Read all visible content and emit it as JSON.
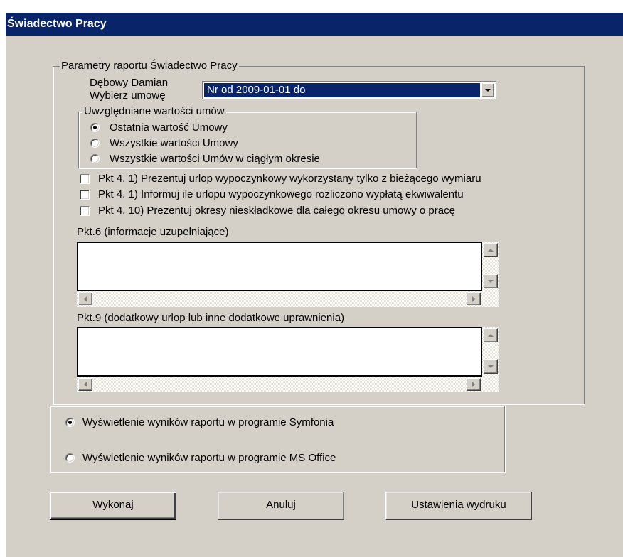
{
  "window": {
    "title": "Świadectwo Pracy"
  },
  "params": {
    "legend": "Parametry raportu  Świadectwo Pracy",
    "employee": "Dębowy Damian",
    "contract_label": "Wybierz umowę",
    "contract_value": "Nr  od 2009-01-01 do",
    "values_group": {
      "legend": "Uwzględniane wartości umów",
      "options": [
        {
          "label": "Ostatnia wartość Umowy",
          "selected": true
        },
        {
          "label": "Wszystkie wartości Umowy",
          "selected": false
        },
        {
          "label": "Wszystkie wartości Umów w ciągłym okresie",
          "selected": false
        }
      ]
    },
    "checkboxes": [
      {
        "label": "Pkt 4. 1) Prezentuj urlop wypoczynkowy wykorzystany tylko z bieżącego wymiaru",
        "checked": false
      },
      {
        "label": "Pkt 4. 1) Informuj ile urlopu wypoczynkowego rozliczono wypłatą ekwiwalentu",
        "checked": false
      },
      {
        "label": "Pkt 4. 10) Prezentuj okresy nieskładkowe dla całego okresu umowy o pracę",
        "checked": false
      }
    ],
    "pkt6": {
      "label": "Pkt.6 (informacje uzupełniające)",
      "value": ""
    },
    "pkt9": {
      "label": "Pkt.9 (dodatkowy urlop lub inne dodatkowe uprawnienia)",
      "value": ""
    }
  },
  "output": {
    "options": [
      {
        "label": "Wyświetlenie wyników raportu w programie Symfonia",
        "selected": true
      },
      {
        "label": "Wyświetlenie wyników raportu w programie MS Office",
        "selected": false
      }
    ]
  },
  "buttons": {
    "execute": "Wykonaj",
    "cancel": "Anuluj",
    "print_settings": "Ustawienia wydruku"
  },
  "colors": {
    "title_bar": "#0a246a",
    "face": "#d4d0c8",
    "selection": "#0a246a"
  }
}
